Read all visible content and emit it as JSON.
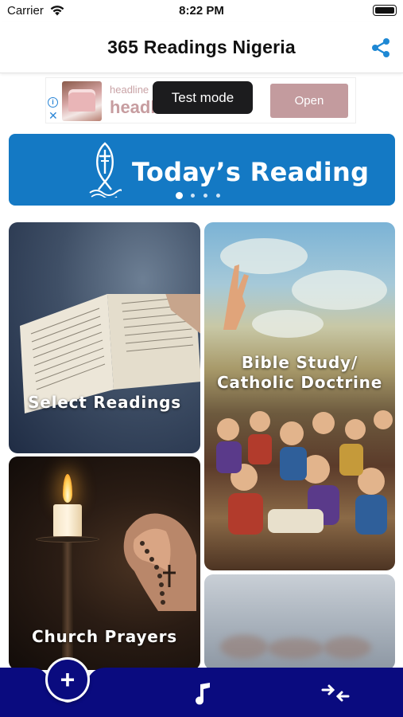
{
  "status_bar": {
    "carrier": "Carrier",
    "time": "8:22 PM"
  },
  "nav": {
    "title": "365 Readings Nigeria",
    "share_icon": "share-icon"
  },
  "ad": {
    "headline_small": "headline",
    "headline_large": "headline",
    "test_mode": "Test mode",
    "open_label": "Open"
  },
  "today_reading": {
    "title": "Today’s Reading",
    "pages": 4,
    "active_page": 1
  },
  "tiles": [
    {
      "label": "Select Readings"
    },
    {
      "label_line1": "Bible Study/",
      "label_line2": "Catholic Doctrine"
    },
    {
      "label": "Church Prayers"
    },
    {
      "label": ""
    }
  ],
  "bottom_bar": {
    "add_icon": "plus-icon",
    "add_label": "+",
    "music_icon": "music-note-icon",
    "swap_icon": "compress-arrows-icon"
  },
  "colors": {
    "accent_blue": "#1479c4",
    "bottom_bar": "#0a0b7f",
    "share_blue": "#1e88d4"
  }
}
